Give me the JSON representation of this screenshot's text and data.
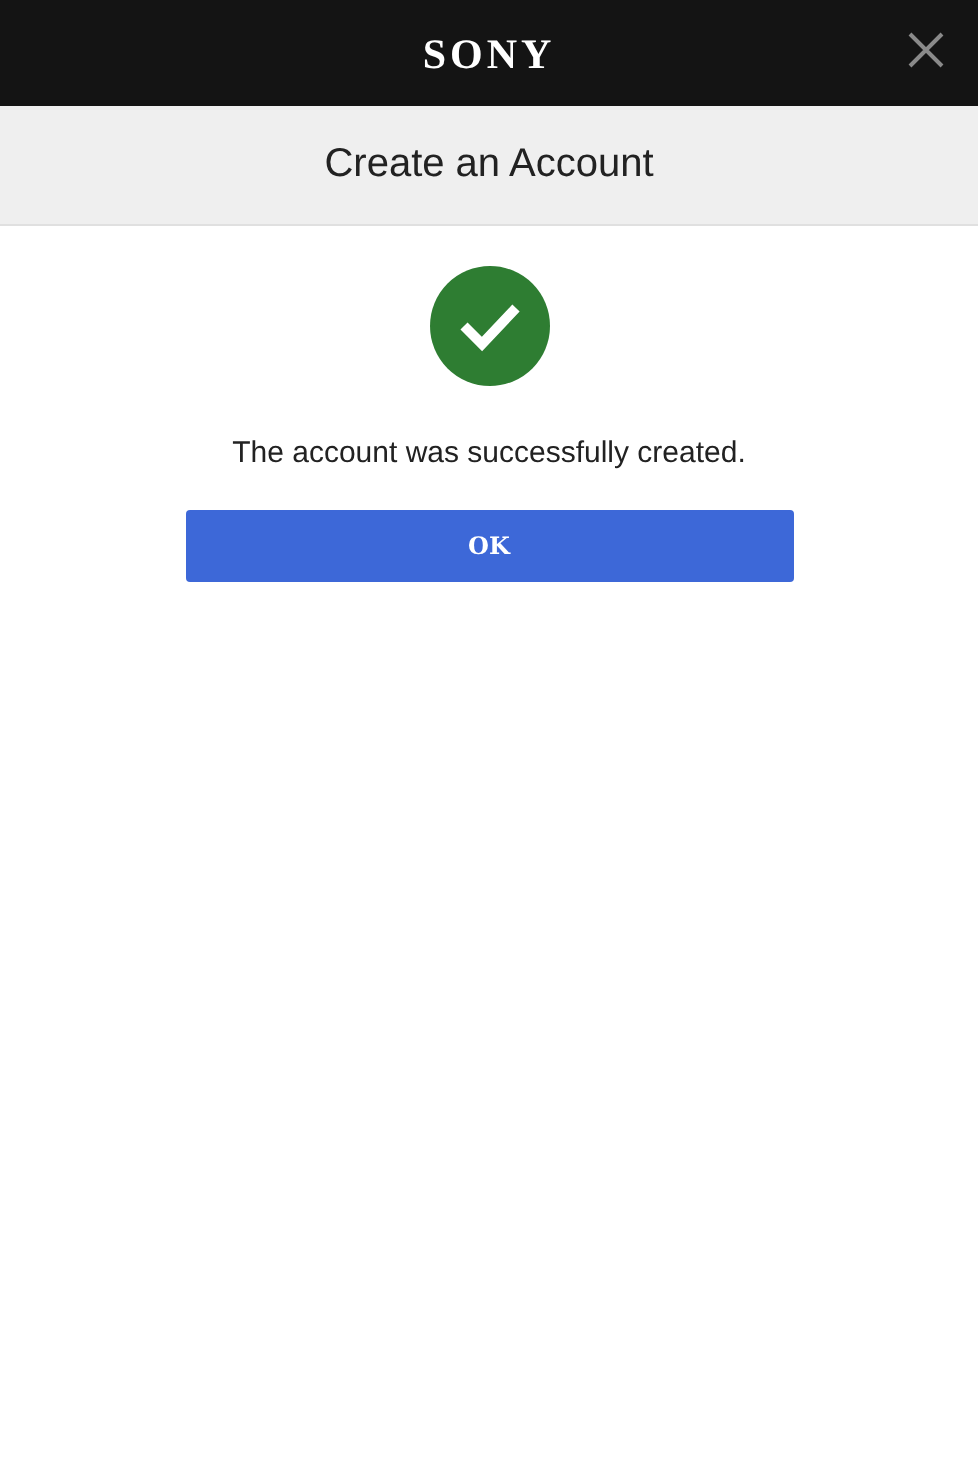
{
  "header": {
    "logo": "SONY"
  },
  "page_title": "Create an Account",
  "message": "The account was successfully created.",
  "status_icon": {
    "kind": "success"
  },
  "buttons": [
    "OK"
  ]
}
